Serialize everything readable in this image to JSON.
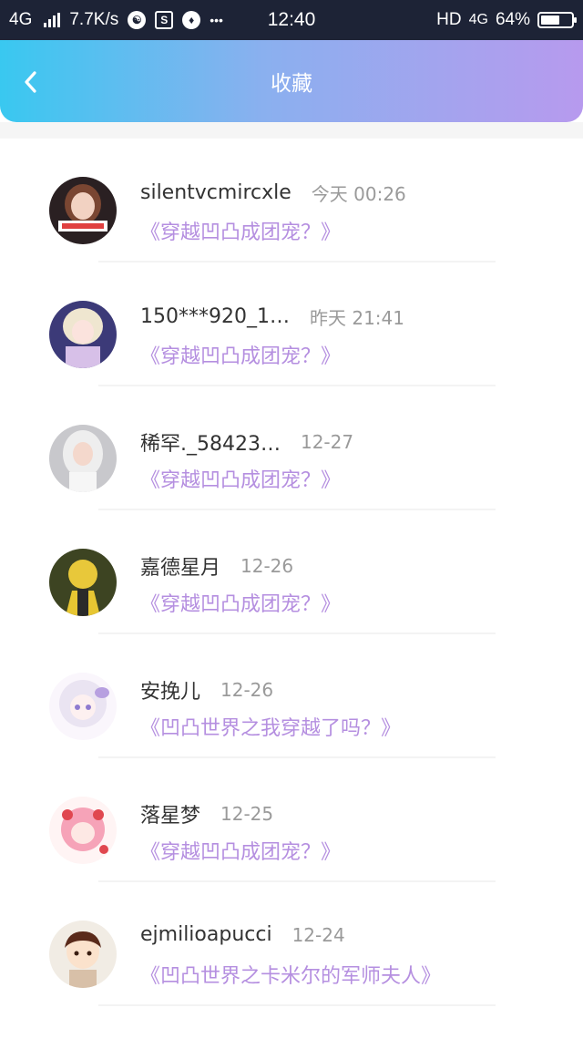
{
  "status_bar": {
    "network": "4G",
    "speed": "7.7K/s",
    "icon_a": "☯",
    "icon_b": "S",
    "icon_c": "♦",
    "dots": "•••",
    "time": "12:40",
    "hd": "HD",
    "net2": "4G",
    "battery": "64%",
    "battery_level": 0.64
  },
  "header": {
    "title": "收藏",
    "back_icon": "chevron-left-icon",
    "gradient": [
      "#39c8f0",
      "#8ab0ef",
      "#b79aee"
    ]
  },
  "colors": {
    "book_title": "#b58fe0",
    "username": "#333333",
    "time": "#9a9a9a"
  },
  "items": [
    {
      "username": "silentvcmircxle",
      "time": "今天 00:26",
      "book": "《穿越凹凸成团宠？》",
      "avatar": "avatar-1"
    },
    {
      "username": "150***920_1…",
      "time": "昨天 21:41",
      "book": "《穿越凹凸成团宠？》",
      "avatar": "avatar-2"
    },
    {
      "username": "稀罕._58423…",
      "time": "12-27",
      "book": "《穿越凹凸成团宠？》",
      "avatar": "avatar-3"
    },
    {
      "username": "嘉德星月",
      "time": "12-26",
      "book": "《穿越凹凸成团宠？》",
      "avatar": "avatar-4"
    },
    {
      "username": "安挽儿",
      "time": "12-26",
      "book": "《凹凸世界之我穿越了吗？》",
      "avatar": "avatar-5"
    },
    {
      "username": "落星梦",
      "time": "12-25",
      "book": "《穿越凹凸成团宠？》",
      "avatar": "avatar-6"
    },
    {
      "username": "ejmilioapucci",
      "time": "12-24",
      "book": "《凹凸世界之卡米尔的军师夫人》",
      "avatar": "avatar-7"
    }
  ]
}
